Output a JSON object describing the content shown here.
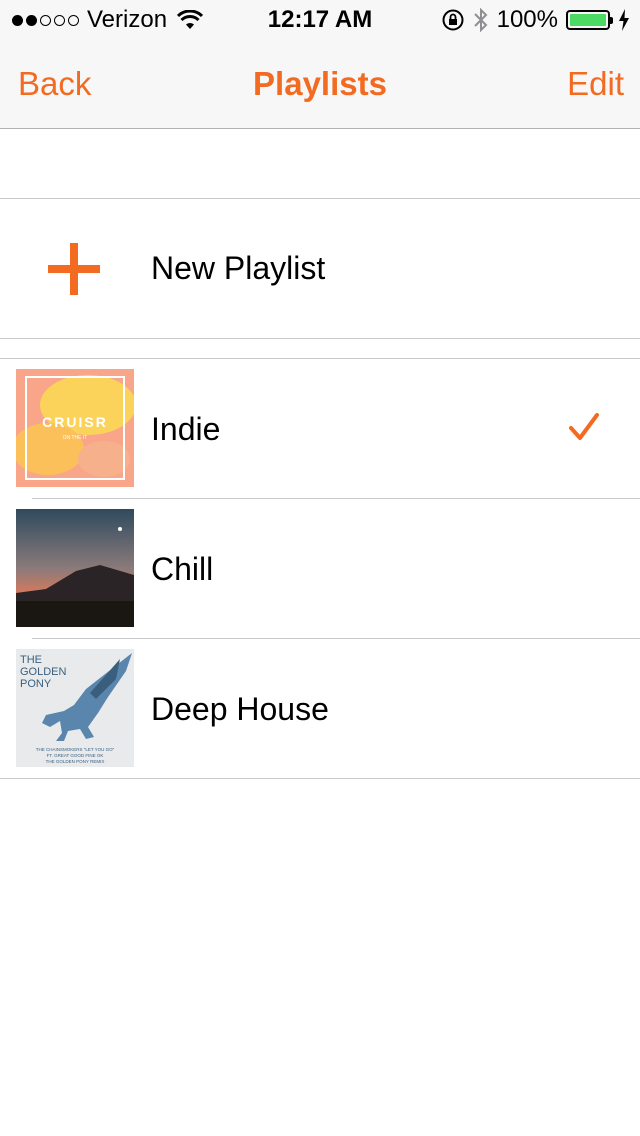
{
  "status_bar": {
    "carrier": "Verizon",
    "time": "12:17 AM",
    "battery": "100%",
    "signal_bars_filled": 2,
    "signal_bars_total": 5
  },
  "nav": {
    "back_label": "Back",
    "title": "Playlists",
    "edit_label": "Edit"
  },
  "new_playlist": {
    "label": "New Playlist",
    "icon": "plus-icon"
  },
  "playlists": [
    {
      "label": "Indie",
      "selected": true,
      "art_text": "CRUISR",
      "art_subtext": "ON THE IT"
    },
    {
      "label": "Chill",
      "selected": false
    },
    {
      "label": "Deep House",
      "selected": false,
      "art_text": "THE GOLDEN PONY",
      "art_subtext": "THE CHAINSMOKERS \"LET YOU GO\" FT. GREAT GOOD FINE OK THE GOLDEN PONY REMIX"
    }
  ],
  "colors": {
    "accent": "#f26b21",
    "battery": "#4cd964",
    "separator": "#c8c7cc",
    "nav_background": "#f7f7f7"
  }
}
